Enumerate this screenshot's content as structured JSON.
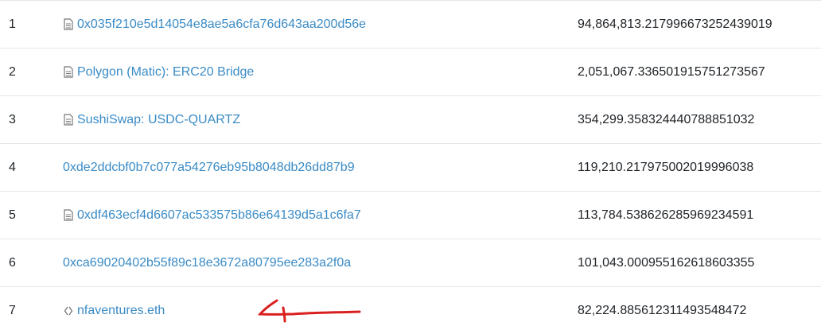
{
  "rows": [
    {
      "rank": "1",
      "icon": "contract-file-icon",
      "address": "0x035f210e5d14054e8ae5a6cfa76d643aa200d56e",
      "quantity": "94,864,813.217996673252439019"
    },
    {
      "rank": "2",
      "icon": "contract-file-icon",
      "address": "Polygon (Matic): ERC20 Bridge",
      "quantity": "2,051,067.336501915751273567"
    },
    {
      "rank": "3",
      "icon": "contract-file-icon",
      "address": "SushiSwap: USDC-QUARTZ",
      "quantity": "354,299.358324440788851032"
    },
    {
      "rank": "4",
      "icon": "",
      "address": "0xde2ddcbf0b7c077a54276eb95b8048db26dd87b9",
      "quantity": "119,210.217975002019996038"
    },
    {
      "rank": "5",
      "icon": "contract-file-icon",
      "address": "0xdf463ecf4d6607ac533575b86e64139d5a1c6fa7",
      "quantity": "113,784.538626285969234591"
    },
    {
      "rank": "6",
      "icon": "",
      "address": "0xca69020402b55f89c18e3672a80795ee283a2f0a",
      "quantity": "101,043.000955162618603355"
    },
    {
      "rank": "7",
      "icon": "ens-name-icon",
      "address": "nfaventures.eth",
      "quantity": "82,224.885612311493548472"
    }
  ],
  "colors": {
    "link": "#3a8bc6",
    "text": "#212529",
    "border": "#e3e6ea",
    "annotation": "#d9201f"
  }
}
